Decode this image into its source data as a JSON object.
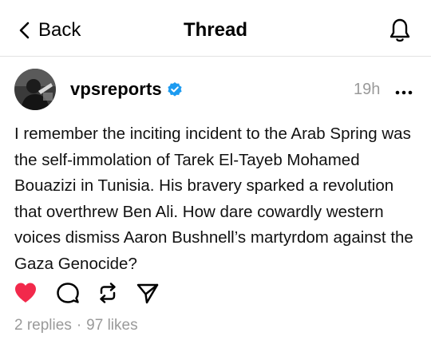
{
  "header": {
    "back_label": "Back",
    "title": "Thread",
    "back_icon": "chevron-left-icon",
    "bell_icon": "bell-icon"
  },
  "post": {
    "username": "vpsreports",
    "verified": true,
    "time": "19h",
    "text": "I remember the inciting incident to the Arab Spring was the self-immolation of Tarek El-Tayeb Mohamed Bouazizi in Tunisia. His bravery sparked a revolution that overthrew Ben Ali. How dare cowardly western voices dismiss Aaron Bushnell’s martyrdom against the Gaza Genocide?",
    "liked": true,
    "replies": "2 replies",
    "separator": "·",
    "likes": "97 likes"
  },
  "colors": {
    "like": "#f2294b",
    "verified": "#1d9bf0",
    "muted": "#9a9a9a"
  },
  "icons": [
    "heart-icon",
    "comment-icon",
    "repost-icon",
    "share-icon",
    "more-icon",
    "verified-badge-icon"
  ]
}
